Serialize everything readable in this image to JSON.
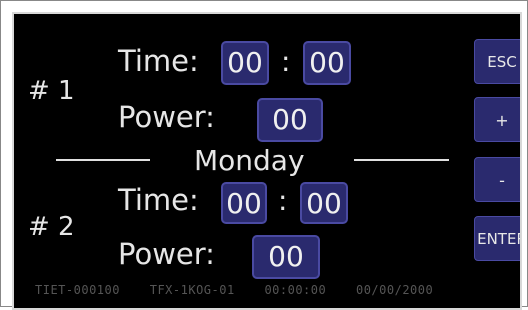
{
  "slot1": {
    "label": "# 1",
    "time_label": "Time:",
    "hours": "00",
    "separator": ":",
    "minutes": "00",
    "power_label": "Power:",
    "power": "00"
  },
  "day": "Monday",
  "slot2": {
    "label": "# 2",
    "time_label": "Time:",
    "hours": "00",
    "separator": ":",
    "minutes": "00",
    "power_label": "Power:",
    "power": "00"
  },
  "buttons": {
    "esc": "ESC",
    "plus": "+",
    "minus": "-",
    "enter": "ENTER"
  },
  "status_bar": {
    "id": "TIET-000100",
    "model": "TFX-1KOG-01",
    "time": "00:00:00",
    "date": "00/00/2000"
  },
  "colors": {
    "screen_bg": "#000000",
    "field_bg": "#2a2a6e",
    "text": "#e6e6e6"
  }
}
